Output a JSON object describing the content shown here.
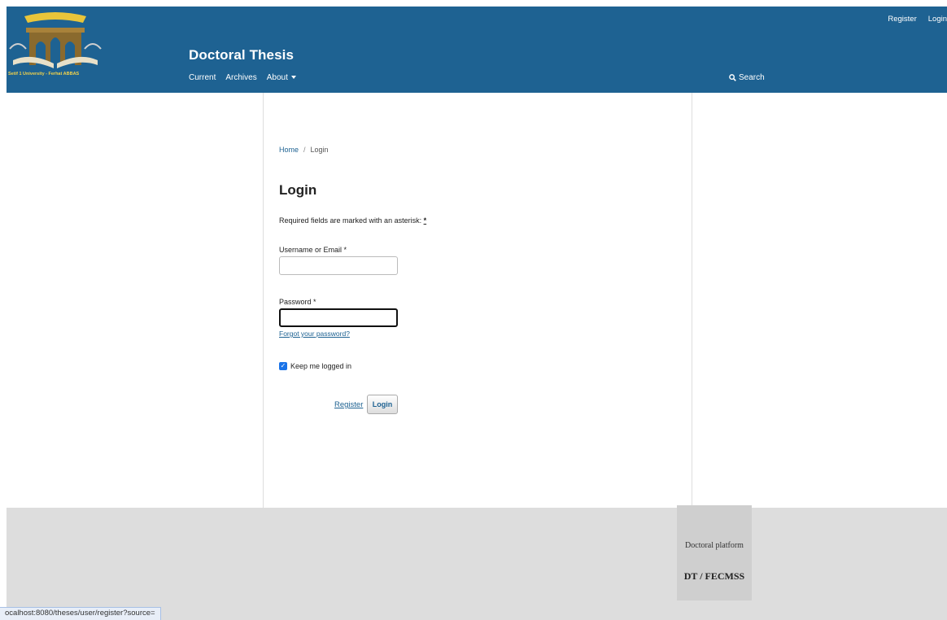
{
  "header": {
    "logo_caption": "Setif 1 University - Ferhat ABBAS",
    "site_title": "Doctoral Thesis",
    "nav": [
      "Current",
      "Archives",
      "About"
    ],
    "search_label": "Search",
    "user_nav": {
      "register": "Register",
      "login": "Login"
    }
  },
  "breadcrumb": {
    "home": "Home",
    "separator": "/",
    "current": "Login"
  },
  "form": {
    "title": "Login",
    "required_note": "Required fields are marked with an asterisk:",
    "required_symbol": "*",
    "username_label": "Username or Email *",
    "username_value": "",
    "password_label": "Password *",
    "password_value": "",
    "forgot_link": "Forgot your password?",
    "remember_label": "Keep me logged in",
    "remember_checked": true,
    "register_link": "Register",
    "login_button": "Login"
  },
  "footer": {
    "platform_line1": "Doctoral platform",
    "platform_line2": "DT / FECMSS"
  },
  "status_bar": {
    "url": "ocalhost:8080/theses/user/register?source="
  },
  "colors": {
    "header_bg": "#1e6292",
    "footer_bg": "#dddddd",
    "link": "#1e6292"
  }
}
